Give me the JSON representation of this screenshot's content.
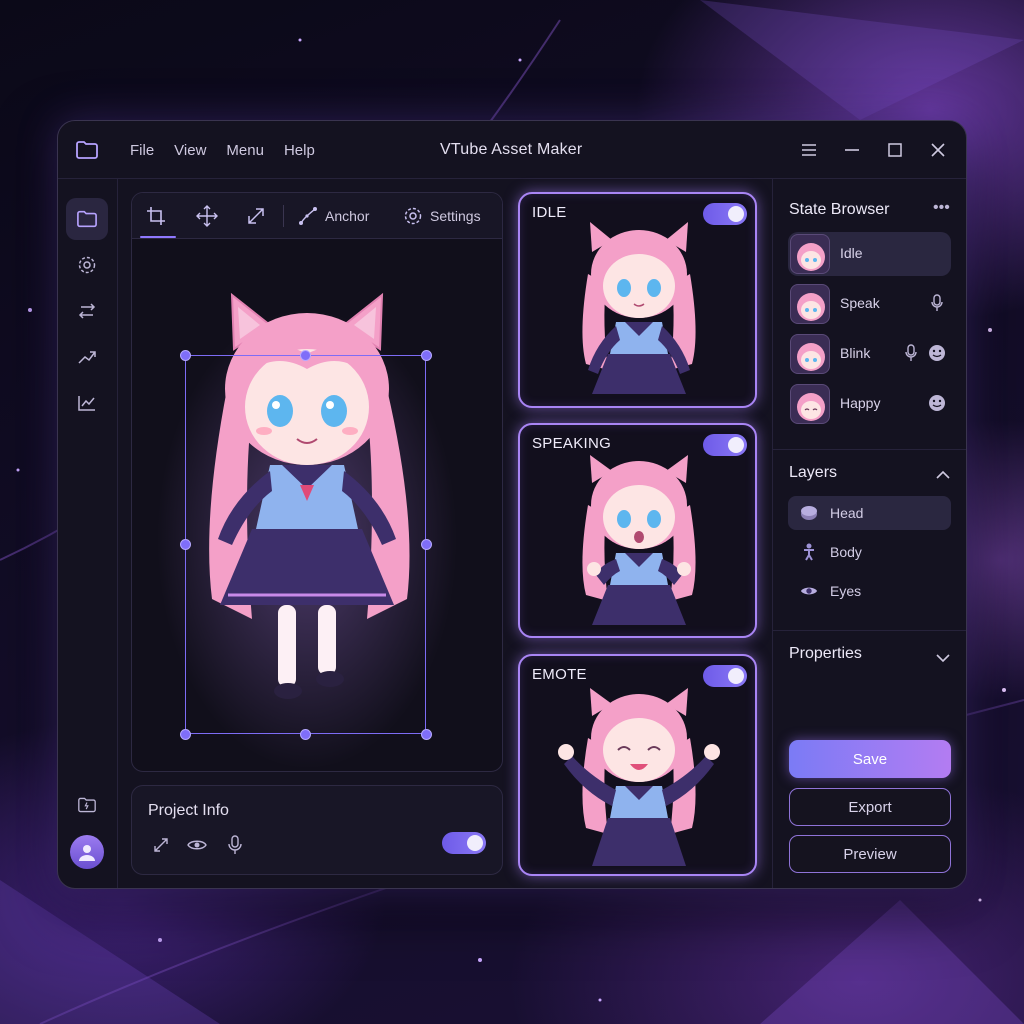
{
  "app": {
    "title": "VTube Asset Maker"
  },
  "menu": [
    "File",
    "View",
    "Menu",
    "Help"
  ],
  "toolbar": {
    "anchor_label": "Anchor",
    "settings_label": "Settings"
  },
  "project": {
    "title": "Project Info",
    "toggle_on": true
  },
  "states": [
    {
      "label": "IDLE",
      "enabled": true
    },
    {
      "label": "SPEAKING",
      "enabled": true
    },
    {
      "label": "EMOTE",
      "enabled": true
    }
  ],
  "sidebar": {
    "state_browser_title": "State Browser",
    "state_items": [
      {
        "name": "Idle",
        "icons": []
      },
      {
        "name": "Speak",
        "icons": [
          "mic-icon"
        ]
      },
      {
        "name": "Blink",
        "icons": [
          "mic-icon",
          "smiley-icon"
        ]
      },
      {
        "name": "Happy",
        "icons": [
          "smiley-icon"
        ]
      }
    ],
    "layers_title": "Layers",
    "layers": [
      {
        "name": "Head",
        "icon": "head-layer-icon"
      },
      {
        "name": "Body",
        "icon": "person-icon"
      },
      {
        "name": "Eyes",
        "icon": "eye-icon"
      }
    ],
    "properties_title": "Properties"
  },
  "actions": {
    "save_label": "Save",
    "export_label": "Export",
    "preview_label": "Preview"
  },
  "colors": {
    "accent": "#8f78ff",
    "hair": "#f4a0c8",
    "outfit": "#3d2f6b",
    "background": "#141220"
  }
}
